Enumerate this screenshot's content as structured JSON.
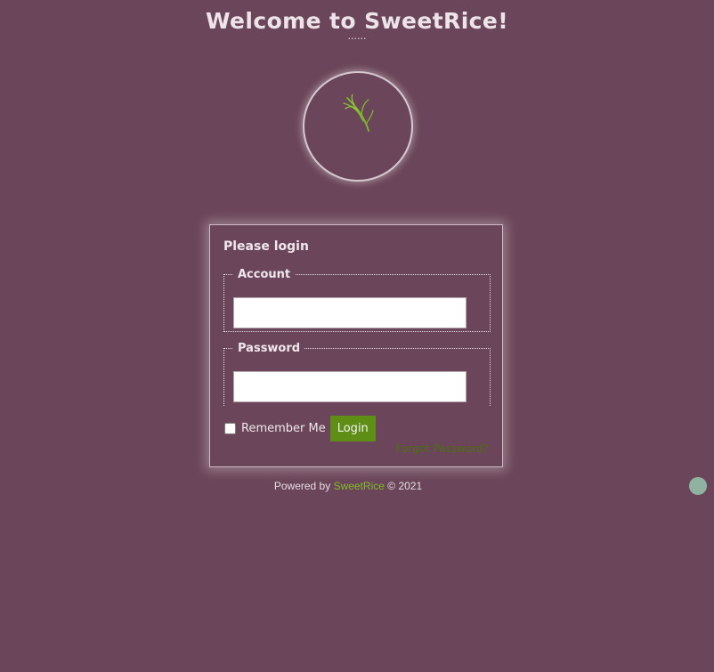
{
  "header": {
    "title": "Welcome to SweetRice!",
    "dots": "......"
  },
  "logo": {
    "icon": "rice-sprig-icon",
    "icon_color": "#7ebc2a"
  },
  "login_form": {
    "heading": "Please login",
    "account_legend": "Account",
    "account_value": "",
    "password_legend": "Password",
    "password_value": "",
    "remember_label": "Remember Me",
    "remember_checked": false,
    "login_button": "Login",
    "forgot_link": "Forgot Password?"
  },
  "footer": {
    "powered_by": "Powered by",
    "brand": "SweetRice",
    "copyright": "© 2021"
  },
  "colors": {
    "background": "#6b4559",
    "accent_green": "#5e8e16",
    "link_green": "#7ebc2a"
  }
}
